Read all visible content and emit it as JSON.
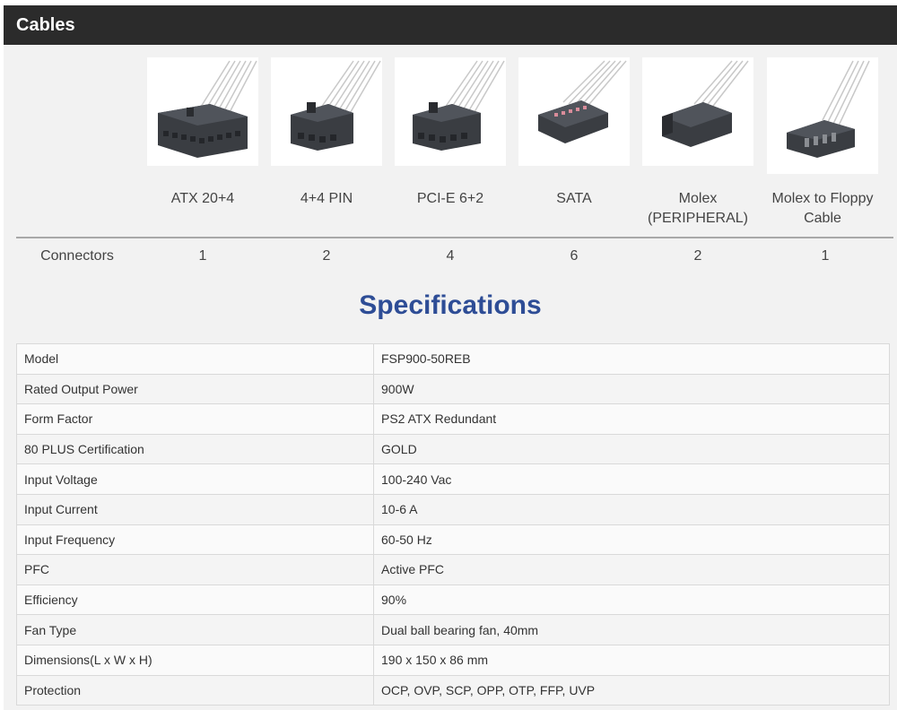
{
  "header": {
    "title": "Cables"
  },
  "cables": [
    {
      "name": "ATX 20+4",
      "icon": "atx-connector-icon",
      "connectors": "1"
    },
    {
      "name": "4+4 PIN",
      "icon": "eps-connector-icon",
      "connectors": "2"
    },
    {
      "name": "PCI-E 6+2",
      "icon": "pcie-connector-icon",
      "connectors": "4"
    },
    {
      "name": "SATA",
      "icon": "sata-connector-icon",
      "connectors": "6"
    },
    {
      "name": "Molex (PERIPHERAL)",
      "icon": "molex-connector-icon",
      "connectors": "2"
    },
    {
      "name": "Molex to Floppy Cable",
      "icon": "floppy-connector-icon",
      "connectors": "1"
    }
  ],
  "connectors_label": "Connectors",
  "specs": {
    "title": "Specifications",
    "rows": [
      {
        "label": "Model",
        "value": "FSP900-50REB"
      },
      {
        "label": "Rated Output Power",
        "value": "900W"
      },
      {
        "label": "Form Factor",
        "value": "PS2 ATX Redundant"
      },
      {
        "label": "80 PLUS Certification",
        "value": "GOLD"
      },
      {
        "label": "Input Voltage",
        "value": "100-240 Vac"
      },
      {
        "label": "Input Current",
        "value": "10-6 A"
      },
      {
        "label": "Input Frequency",
        "value": "60-50 Hz"
      },
      {
        "label": "PFC",
        "value": "Active PFC"
      },
      {
        "label": "Efficiency",
        "value": "90%"
      },
      {
        "label": "Fan Type",
        "value": "Dual ball bearing fan, 40mm"
      },
      {
        "label": "Dimensions(L x W x H)",
        "value": "190 x 150 x 86 mm"
      },
      {
        "label": "Protection",
        "value": "OCP, OVP, SCP, OPP, OTP, FFP, UVP"
      }
    ]
  },
  "colors": {
    "header_bg": "#2b2b2b",
    "title": "#2e4d96",
    "connector": "#3a3d42"
  }
}
